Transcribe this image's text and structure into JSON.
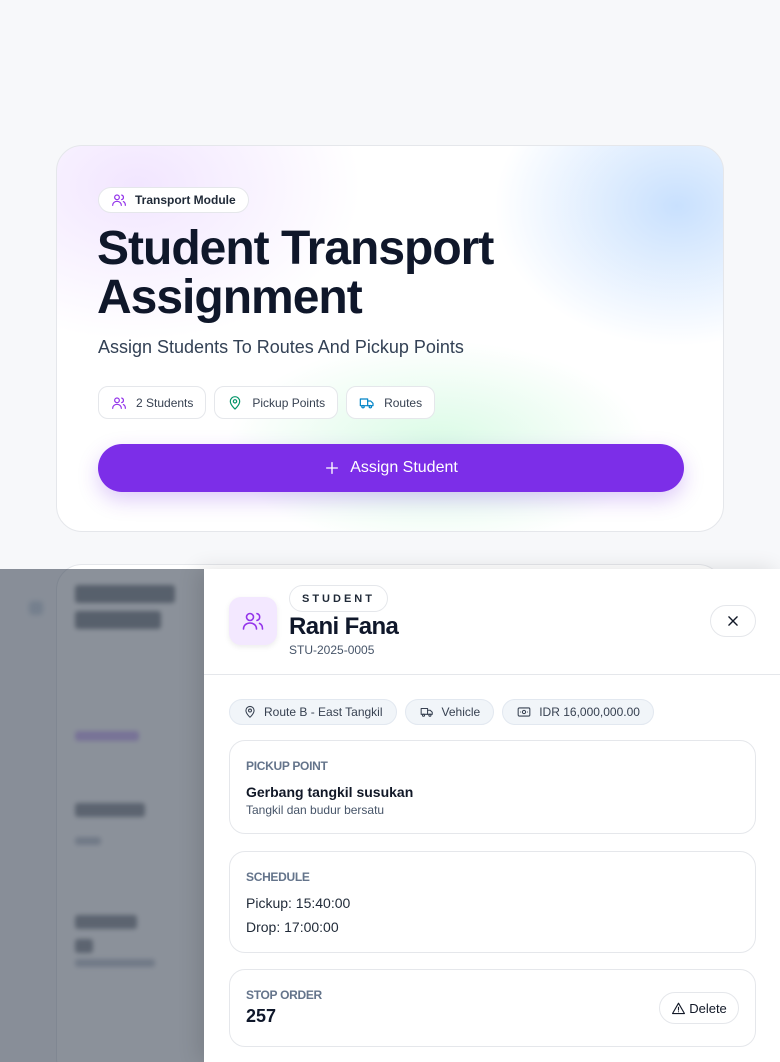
{
  "hero": {
    "badge": "Transport Module",
    "title": "Student Transport Assignment",
    "subtitle": "Assign Students To Routes And Pickup Points",
    "chips": [
      "2 Students",
      "Pickup Points",
      "Routes"
    ],
    "assign_button": "Assign Student"
  },
  "drawer": {
    "role": "STUDENT",
    "name": "Rani Fana",
    "student_id": "STU-2025-0005",
    "tags": {
      "route": "Route B - East Tangkil",
      "vehicle": "Vehicle",
      "fee": "IDR 16,000,000.00"
    },
    "pickup": {
      "label": "PICKUP POINT",
      "name": "Gerbang tangkil susukan",
      "description": "Tangkil dan budur bersatu"
    },
    "schedule": {
      "label": "SCHEDULE",
      "pickup": "Pickup: 15:40:00",
      "drop": "Drop: 17:00:00"
    },
    "stop_order": {
      "label": "STOP ORDER",
      "value": "257"
    },
    "delete_button": "Delete"
  },
  "colors": {
    "accent": "#7c2ee8",
    "avatar_bg": "#f3e8ff"
  }
}
